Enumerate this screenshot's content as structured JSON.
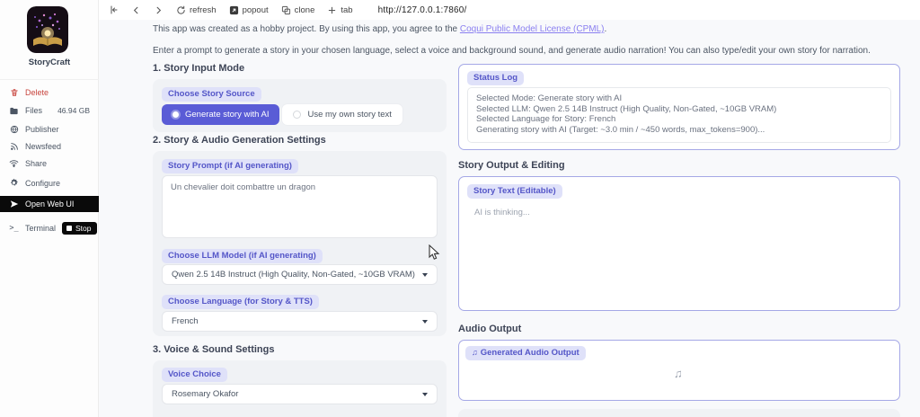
{
  "colors": {
    "accent": "#5a5cd6",
    "pill_bg": "#dfe1f9",
    "pill_text": "#5456c8",
    "panel_border": "#a5a8e6",
    "link": "#8a7ff0",
    "delete_red": "#c8453e",
    "active_row_bg": "#0a0a0a"
  },
  "browser_toolbar": {
    "refresh_label": "refresh",
    "popout_label": "popout",
    "clone_label": "clone",
    "tab_label": "tab",
    "url": "http://127.0.0.1:7860/"
  },
  "sidebar": {
    "app_name": "StoryCraft",
    "items": [
      {
        "label": "Delete"
      },
      {
        "label": "Files",
        "value": "46.94 GB"
      },
      {
        "label": "Publisher"
      },
      {
        "label": "Newsfeed"
      },
      {
        "label": "Share"
      },
      {
        "label": "Configure"
      },
      {
        "label": "Open Web UI"
      },
      {
        "label": "Terminal"
      }
    ],
    "stop_label": "Stop"
  },
  "main_intro": {
    "disclaimer_prefix": "This app was created as a hobby project. By using this app, you agree to the ",
    "license_link_text": "Coqui Public Model License (CPML)",
    "disclaimer_suffix": ".",
    "intro_text": "Enter a prompt to generate a story in your chosen language, select a voice and background sound, and generate audio narration! You can also type/edit your own story for narration."
  },
  "left_column": {
    "section1_title": "1. Story Input Mode",
    "story_source_label": "Choose Story Source",
    "radio_options": [
      {
        "label": "Generate story with AI",
        "selected": true
      },
      {
        "label": "Use my own story text",
        "selected": false
      }
    ],
    "section2_title": "2. Story & Audio Generation Settings",
    "story_prompt_label": "Story Prompt (if AI generating)",
    "story_prompt_value": "Un chevalier doit combattre un dragon",
    "llm_label": "Choose LLM Model (if AI generating)",
    "llm_value": "Qwen 2.5 14B Instruct (High Quality, Non-Gated, ~10GB VRAM)",
    "language_label": "Choose Language (for Story & TTS)",
    "language_value": "French",
    "section3_title": "3. Voice & Sound Settings",
    "voice_label": "Voice Choice",
    "voice_value": "Rosemary Okafor"
  },
  "right_column": {
    "status_log_label": "Status Log",
    "status_lines": [
      "Selected Mode: Generate story with AI",
      "Selected LLM: Qwen 2.5 14B Instruct (High Quality, Non-Gated, ~10GB VRAM)",
      "Selected Language for Story: French",
      "Generating story with AI (Target: ~3.0 min / ~450 words, max_tokens=900)..."
    ],
    "story_output_title": "Story Output & Editing",
    "story_text_label": "Story Text (Editable)",
    "story_text_value": "AI is thinking...",
    "audio_output_title": "Audio Output",
    "audio_label": "Generated Audio Output"
  },
  "icons": {
    "music_note": "♫",
    "terminal_glyph": ">_"
  }
}
